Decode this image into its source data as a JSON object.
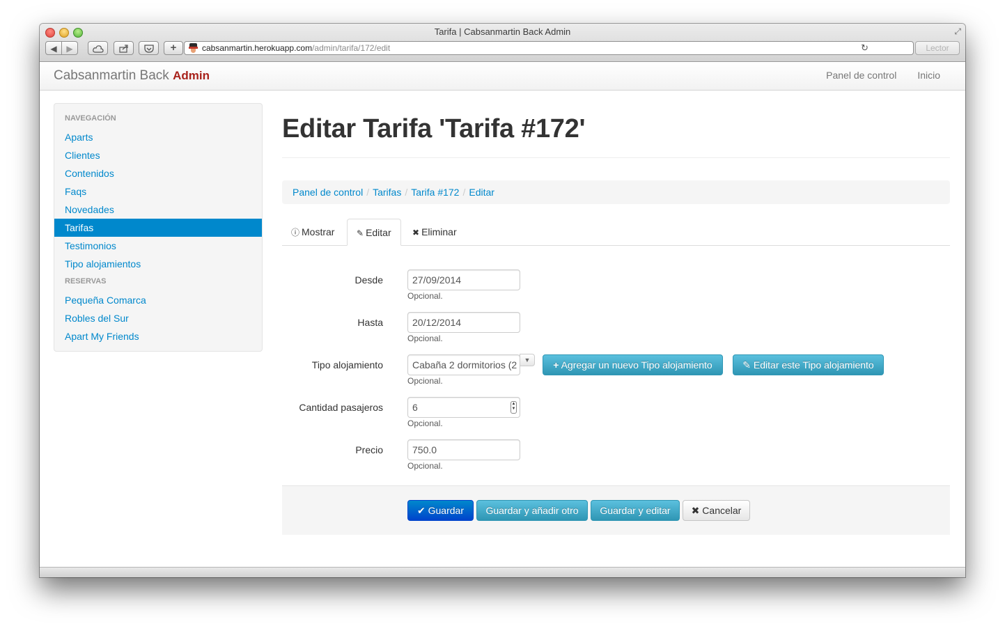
{
  "browser": {
    "window_title": "Tarifa | Cabsanmartin Back Admin",
    "url_host": "cabsanmartin.herokuapp.com",
    "url_path": "/admin/tarifa/172/edit",
    "reader_label": "Lector",
    "icons": [
      "back-icon",
      "forward-icon",
      "icloud-icon",
      "share-icon",
      "pocket-icon",
      "plus-icon",
      "reload-icon",
      "fullscreen-icon"
    ]
  },
  "navbar": {
    "brand_prefix": "Cabsanmartin Back ",
    "brand_strong": "Admin",
    "links": [
      "Panel de control",
      "Inicio"
    ]
  },
  "sidebar": {
    "sections": [
      {
        "header": "NAVEGACIÓN",
        "items": [
          "Aparts",
          "Clientes",
          "Contenidos",
          "Faqs",
          "Novedades",
          "Tarifas",
          "Testimonios",
          "Tipo alojamientos"
        ]
      },
      {
        "header": "RESERVAS",
        "items": [
          "Pequeña Comarca",
          "Robles del Sur",
          "Apart My Friends"
        ]
      }
    ],
    "active_item": "Tarifas"
  },
  "page": {
    "title": "Editar Tarifa 'Tarifa #172'",
    "breadcrumb": [
      "Panel de control",
      "Tarifas",
      "Tarifa #172",
      "Editar"
    ],
    "tabs": [
      {
        "label": "Mostrar",
        "icon": "info-circle-icon"
      },
      {
        "label": "Editar",
        "icon": "pencil-icon"
      },
      {
        "label": "Eliminar",
        "icon": "close-icon"
      }
    ],
    "active_tab": "Editar"
  },
  "form": {
    "help_text": "Opcional.",
    "desde": {
      "label": "Desde",
      "value": "27/09/2014"
    },
    "hasta": {
      "label": "Hasta",
      "value": "20/12/2014"
    },
    "tipo_alojamiento": {
      "label": "Tipo alojamiento",
      "value": "Cabaña 2 dormitorios (2",
      "add_button": "Agregar un nuevo Tipo alojamiento",
      "edit_button": "Editar este Tipo alojamiento"
    },
    "cantidad_pasajeros": {
      "label": "Cantidad pasajeros",
      "value": "6"
    },
    "precio": {
      "label": "Precio",
      "value": "750.0"
    }
  },
  "actions": {
    "save": "Guardar",
    "save_add": "Guardar y añadir otro",
    "save_edit": "Guardar y editar",
    "cancel": "Cancelar"
  },
  "colors": {
    "link": "#0088cc",
    "brand_accent": "#a8221b",
    "primary": "#0044cc",
    "info": "#5bc0de"
  }
}
